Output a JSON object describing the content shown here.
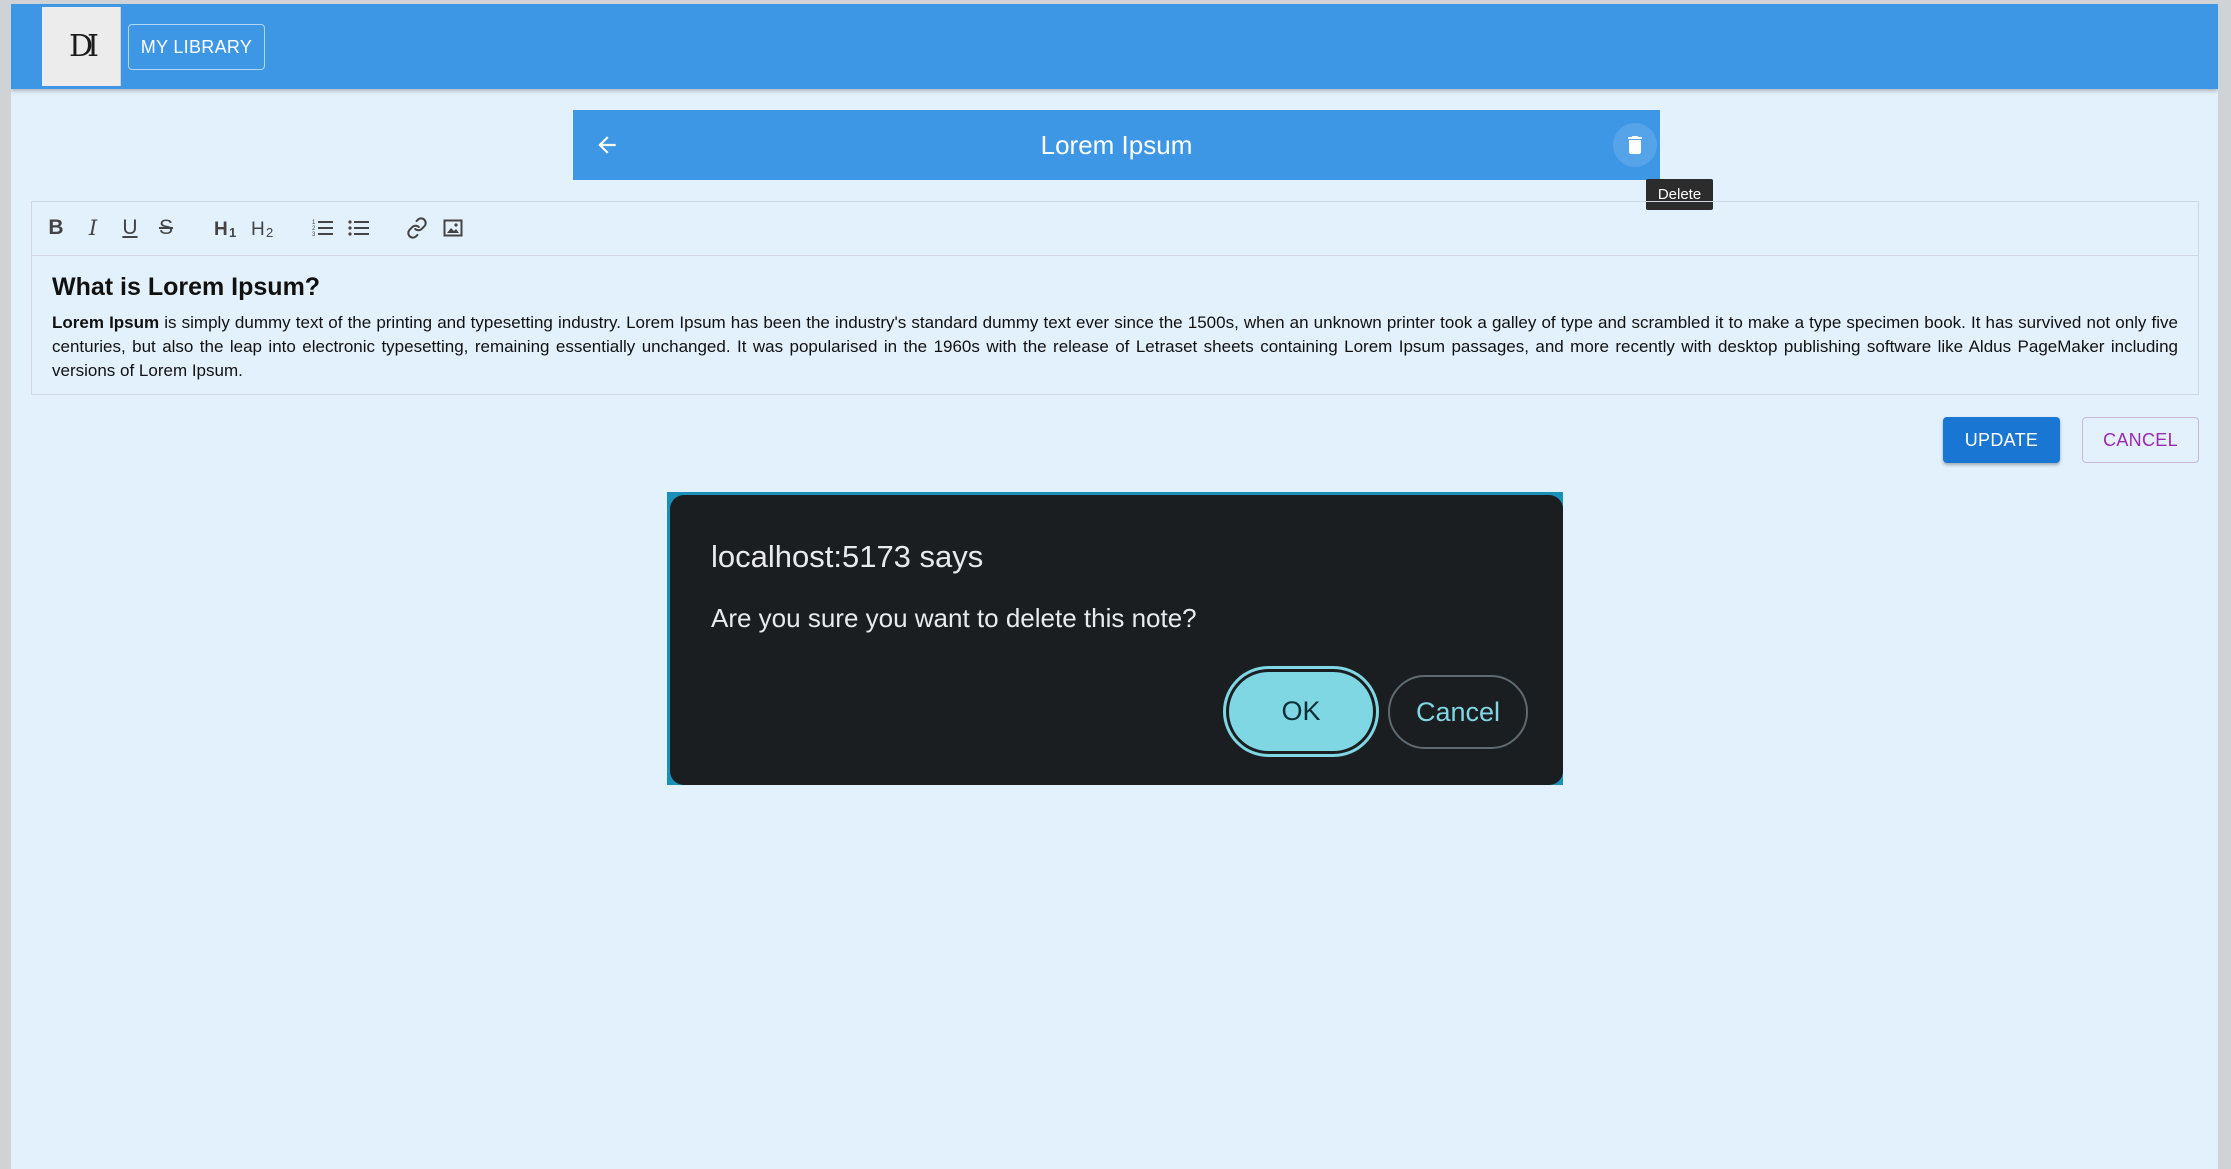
{
  "header": {
    "logo_text": "DI",
    "library_label": "MY LIBRARY"
  },
  "note": {
    "title": "Lorem Ipsum",
    "delete_tooltip": "Delete"
  },
  "editor": {
    "toolbar": [
      {
        "name": "bold",
        "glyph": "B"
      },
      {
        "name": "italic",
        "glyph": "I"
      },
      {
        "name": "underline",
        "glyph": "U"
      },
      {
        "name": "strikethrough",
        "glyph": "S"
      },
      {
        "name": "heading-1",
        "glyph": "H1"
      },
      {
        "name": "heading-2",
        "glyph": "H2"
      },
      {
        "name": "ordered-list",
        "glyph": "ol"
      },
      {
        "name": "bullet-list",
        "glyph": "ul"
      },
      {
        "name": "link",
        "glyph": "link"
      },
      {
        "name": "image",
        "glyph": "image"
      }
    ],
    "heading": "What is Lorem Ipsum?",
    "body_bold": "Lorem Ipsum",
    "body_rest": " is simply dummy text of the printing and typesetting industry. Lorem Ipsum has been the industry's standard dummy text ever since the 1500s, when an unknown printer took a galley of type and scrambled it to make a type specimen book. It has survived not only five centuries, but also the leap into electronic typesetting, remaining essentially unchanged. It was popularised in the 1960s with the release of Letraset sheets containing Lorem Ipsum passages, and more recently with desktop publishing software like Aldus PageMaker including versions of Lorem Ipsum."
  },
  "actions": {
    "update_label": "UPDATE",
    "cancel_label": "CANCEL"
  },
  "dialog": {
    "title": "localhost:5173 says",
    "message": "Are you sure you want to delete this note?",
    "ok_label": "OK",
    "cancel_label": "Cancel"
  },
  "colors": {
    "primary": "#3e97e5",
    "background": "#e3f1fc",
    "update_button": "#1976d2",
    "cancel_text": "#9c27b0",
    "dialog_bg": "#1b1e21",
    "dialog_accent": "#7fd7e3"
  }
}
